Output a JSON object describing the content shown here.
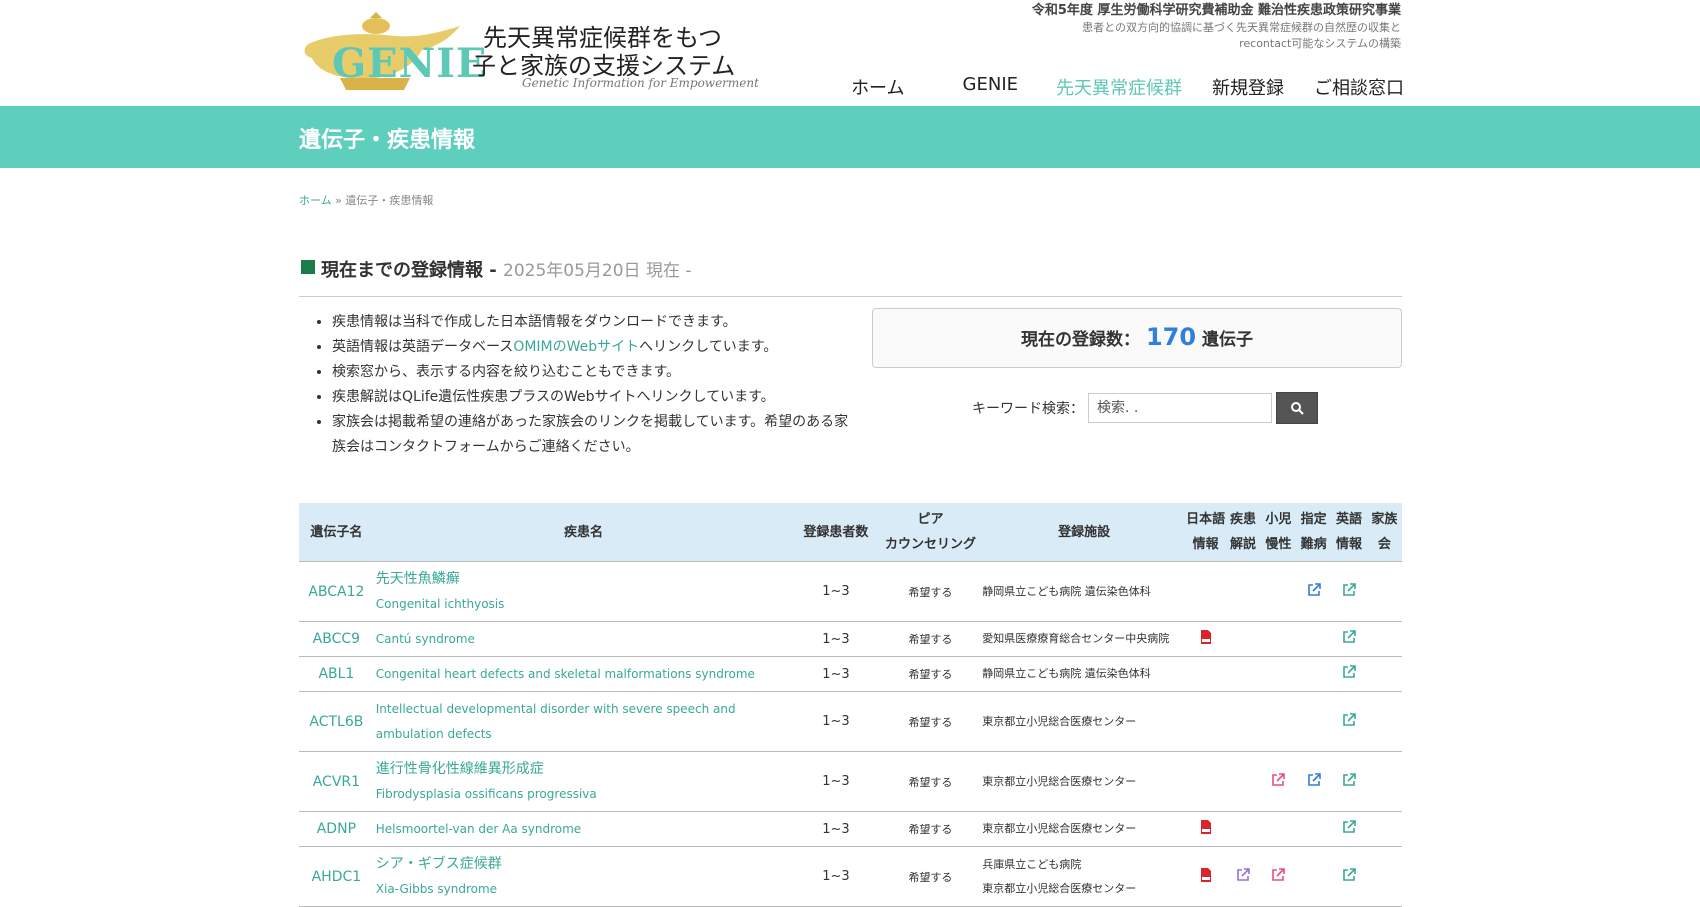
{
  "header": {
    "logo_word": "GENIE",
    "logo_title_line1": "先天異常症候群をもつ",
    "logo_title_line2": "子と家族の支援システム",
    "logo_subtitle": "Genetic Information for Empowerment",
    "grant_title": "令和5年度 厚生労働科学研究費補助金 難治性疾患政策研究事業",
    "grant_line1": "患者との双方向的協調に基づく先天異常症候群の自然歴の収集と",
    "grant_line2": "recontact可能なシステムの構築"
  },
  "nav": {
    "items": [
      {
        "label": "ホーム"
      },
      {
        "label": "GENIE"
      },
      {
        "label": "先天異常症候群"
      },
      {
        "label": "新規登録"
      },
      {
        "label": "ご相談窓口"
      }
    ],
    "active_color": "#5ec8b6"
  },
  "band": {
    "title": "遺伝子・疾患情報",
    "color": "#5ecfbc"
  },
  "breadcrumb": {
    "home": "ホーム",
    "separator": "»",
    "current": "遺伝子・疾患情報"
  },
  "section": {
    "title": "現在までの登録情報 - ",
    "date": "2025年05月20日 現在 -"
  },
  "notes": {
    "item1": "疾患情報は当科で作成した日本語情報をダウンロードできます。",
    "item2_pre": "英語情報は英語データベース",
    "item2_link": "OMIMのWebサイト",
    "item2_post": "へリンクしています。",
    "item3": "検索窓から、表示する内容を絞り込むこともできます。",
    "item4": "疾患解説はQLife遺伝性疾患プラスのWebサイトへリンクしています。",
    "item5": "家族会は掲載希望の連絡があった家族会のリンクを掲載しています。希望のある家族会はコンタクトフォームからご連絡ください。"
  },
  "count": {
    "label": "現在の登録数：",
    "value": "170",
    "unit": "遺伝子"
  },
  "search": {
    "label": "キーワード検索：",
    "placeholder": "検索. ."
  },
  "table": {
    "headers": {
      "gene": "遺伝子名",
      "disease": "疾患名",
      "patients": "登録患者数",
      "peer_line1": "ピア",
      "peer_line2": "カウンセリング",
      "facility": "登録施設",
      "ja_line1": "日本語",
      "ja_line2": "情報",
      "exp_line1": "疾患",
      "exp_line2": "解説",
      "child_line1": "小児",
      "child_line2": "慢性",
      "des_line1": "指定",
      "des_line2": "難病",
      "en_line1": "英語",
      "en_line2": "情報",
      "fam_line1": "家族",
      "fam_line2": "会"
    },
    "rows": [
      {
        "gene": "ABCA12",
        "disease_ja": "先天性魚鱗癬",
        "disease_en": "Congenital ichthyosis",
        "patients": "1~3",
        "peer": "希望する",
        "facility_line1": "静岡県立こども病院 遺伝染色体科",
        "facility_line2": ""
      },
      {
        "gene": "ABCC9",
        "disease_ja": "",
        "disease_en": "Cantú syndrome",
        "patients": "1~3",
        "peer": "希望する",
        "facility_line1": "愛知県医療療育総合センター中央病院",
        "facility_line2": ""
      },
      {
        "gene": "ABL1",
        "disease_ja": "",
        "disease_en": "Congenital heart defects and skeletal malformations syndrome",
        "patients": "1~3",
        "peer": "希望する",
        "facility_line1": "静岡県立こども病院 遺伝染色体科",
        "facility_line2": ""
      },
      {
        "gene": "ACTL6B",
        "disease_ja": "",
        "disease_en": "Intellectual developmental disorder with severe speech and ambulation defects",
        "patients": "1~3",
        "peer": "希望する",
        "facility_line1": "東京都立小児総合医療センター",
        "facility_line2": ""
      },
      {
        "gene": "ACVR1",
        "disease_ja": "進行性骨化性線維異形成症",
        "disease_en": "Fibrodysplasia ossificans progressiva",
        "patients": "1~3",
        "peer": "希望する",
        "facility_line1": "東京都立小児総合医療センター",
        "facility_line2": ""
      },
      {
        "gene": "ADNP",
        "disease_ja": "",
        "disease_en": "Helsmoortel-van der Aa syndrome",
        "patients": "1~3",
        "peer": "希望する",
        "facility_line1": "東京都立小児総合医療センター",
        "facility_line2": ""
      },
      {
        "gene": "AHDC1",
        "disease_ja": "シア・ギブス症候群",
        "disease_en": "Xia-Gibbs syndrome",
        "patients": "1~3",
        "peer": "希望する",
        "facility_line1": "兵庫県立こども病院",
        "facility_line2": "東京都立小児総合医療センター"
      }
    ],
    "icons": {
      "pdf_color": "#d9232d",
      "link_blue": "#2f7fdc",
      "link_green": "#3aa898",
      "link_pink": "#e64f7a",
      "link_purple": "#9b6fd6"
    }
  }
}
